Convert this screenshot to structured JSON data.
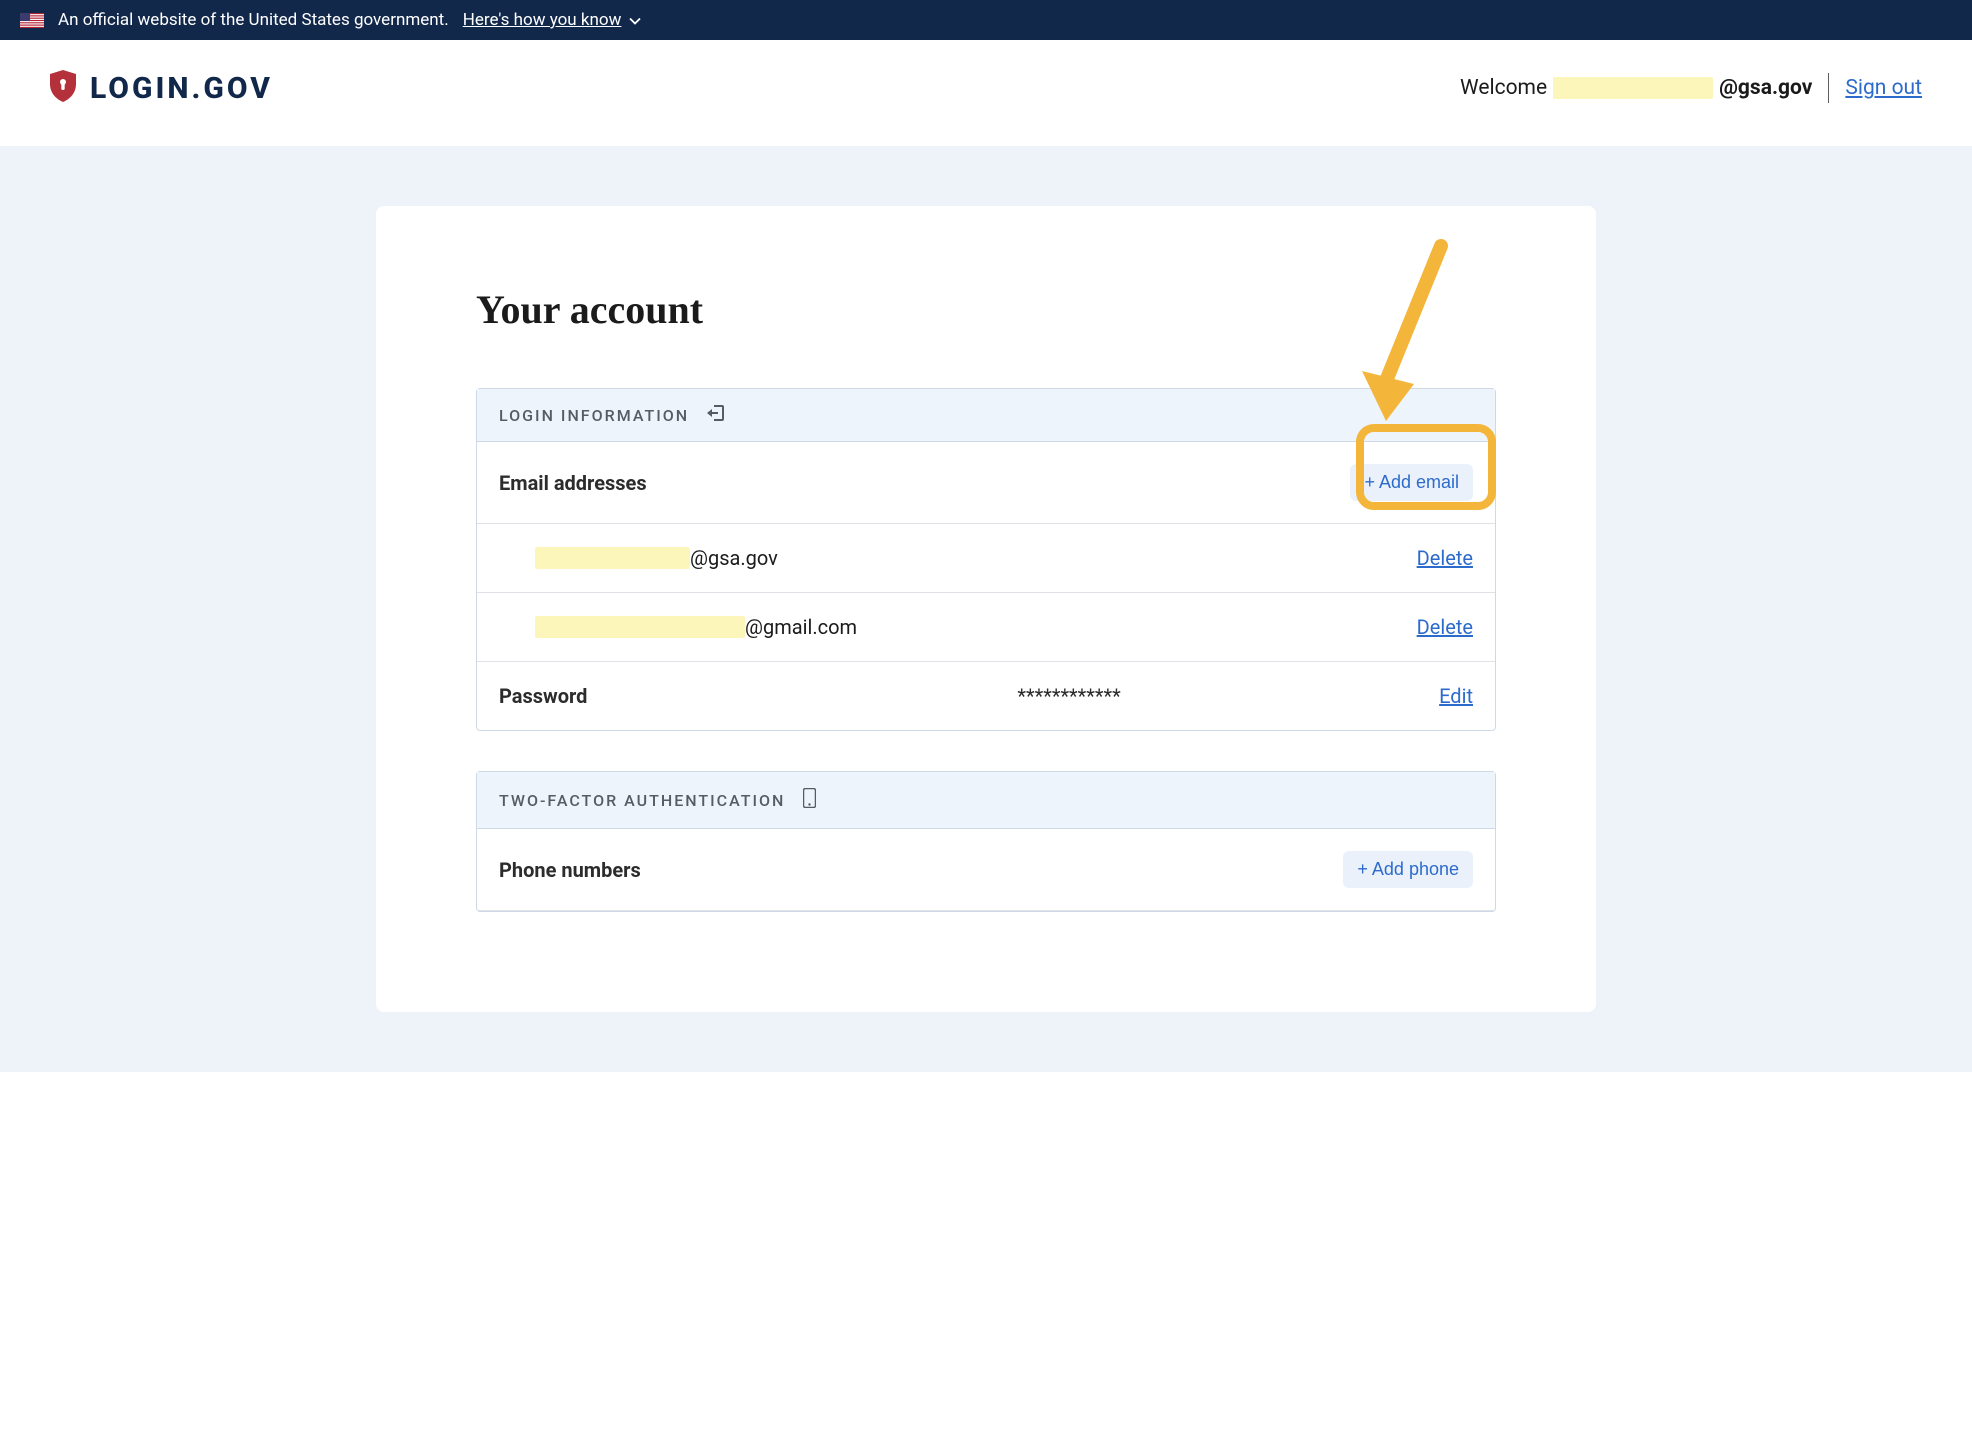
{
  "gov_banner": {
    "text": "An official website of the United States government.",
    "how_link": "Here's how you know"
  },
  "header": {
    "logo_text": "LOGIN.GOV",
    "welcome": "Welcome",
    "email_suffix": "@gsa.gov",
    "sign_out": "Sign out"
  },
  "page": {
    "title": "Your account"
  },
  "login_panel": {
    "header": "LOGIN INFORMATION",
    "email_label": "Email addresses",
    "add_email": "+ Add email",
    "emails": [
      {
        "suffix": "@gsa.gov",
        "action": "Delete"
      },
      {
        "suffix": "@gmail.com",
        "action": "Delete"
      }
    ],
    "password_label": "Password",
    "password_value": "************",
    "password_action": "Edit"
  },
  "twofa_panel": {
    "header": "TWO-FACTOR AUTHENTICATION",
    "phone_label": "Phone numbers",
    "add_phone": "+ Add phone"
  }
}
